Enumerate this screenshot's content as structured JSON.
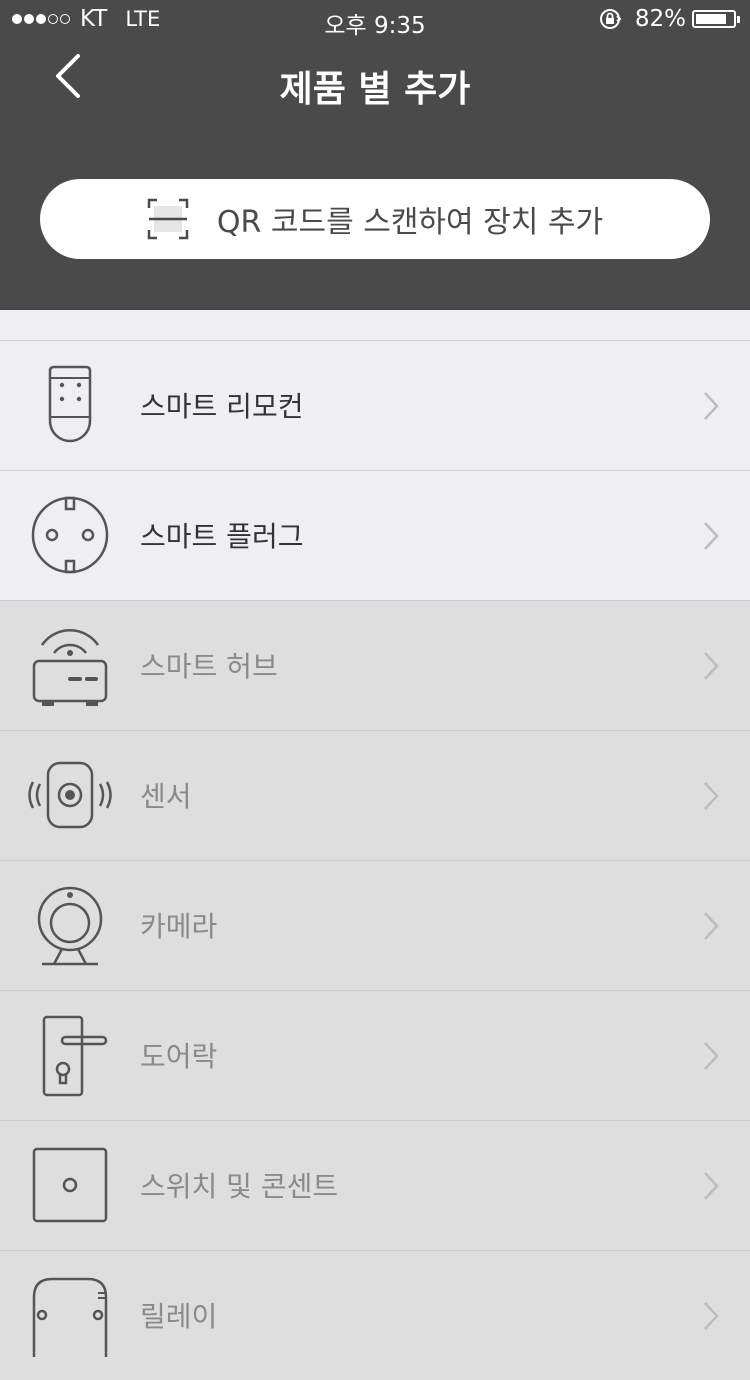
{
  "status_bar": {
    "carrier": "KT",
    "network": "LTE",
    "time": "오후 9:35",
    "battery_percent": "82%",
    "battery_level": 0.82,
    "signal_bars": 3,
    "signal_total": 5
  },
  "nav": {
    "title": "제품 별 추가",
    "back_icon": "chevron-left-icon"
  },
  "qr_button": {
    "label": "QR 코드를 스캔하여 장치 추가",
    "icon": "qr-scan-icon"
  },
  "colors": {
    "header_bg": "#4a4a4a",
    "enabled_row_bg": "#efeef3",
    "disabled_row_bg": "#dedede",
    "enabled_text": "#333333",
    "disabled_text": "#8a8a8a",
    "chevron": "#bdbdbd"
  },
  "categories": [
    {
      "label": "스마트 리모컨",
      "icon": "remote-control-icon",
      "enabled": true
    },
    {
      "label": "스마트 플러그",
      "icon": "smart-plug-icon",
      "enabled": true
    },
    {
      "label": "스마트 허브",
      "icon": "smart-hub-icon",
      "enabled": false
    },
    {
      "label": "센서",
      "icon": "sensor-icon",
      "enabled": false
    },
    {
      "label": "카메라",
      "icon": "camera-icon",
      "enabled": false
    },
    {
      "label": "도어락",
      "icon": "door-lock-icon",
      "enabled": false
    },
    {
      "label": "스위치 및 콘센트",
      "icon": "switch-outlet-icon",
      "enabled": false
    },
    {
      "label": "릴레이",
      "icon": "relay-icon",
      "enabled": false
    }
  ]
}
